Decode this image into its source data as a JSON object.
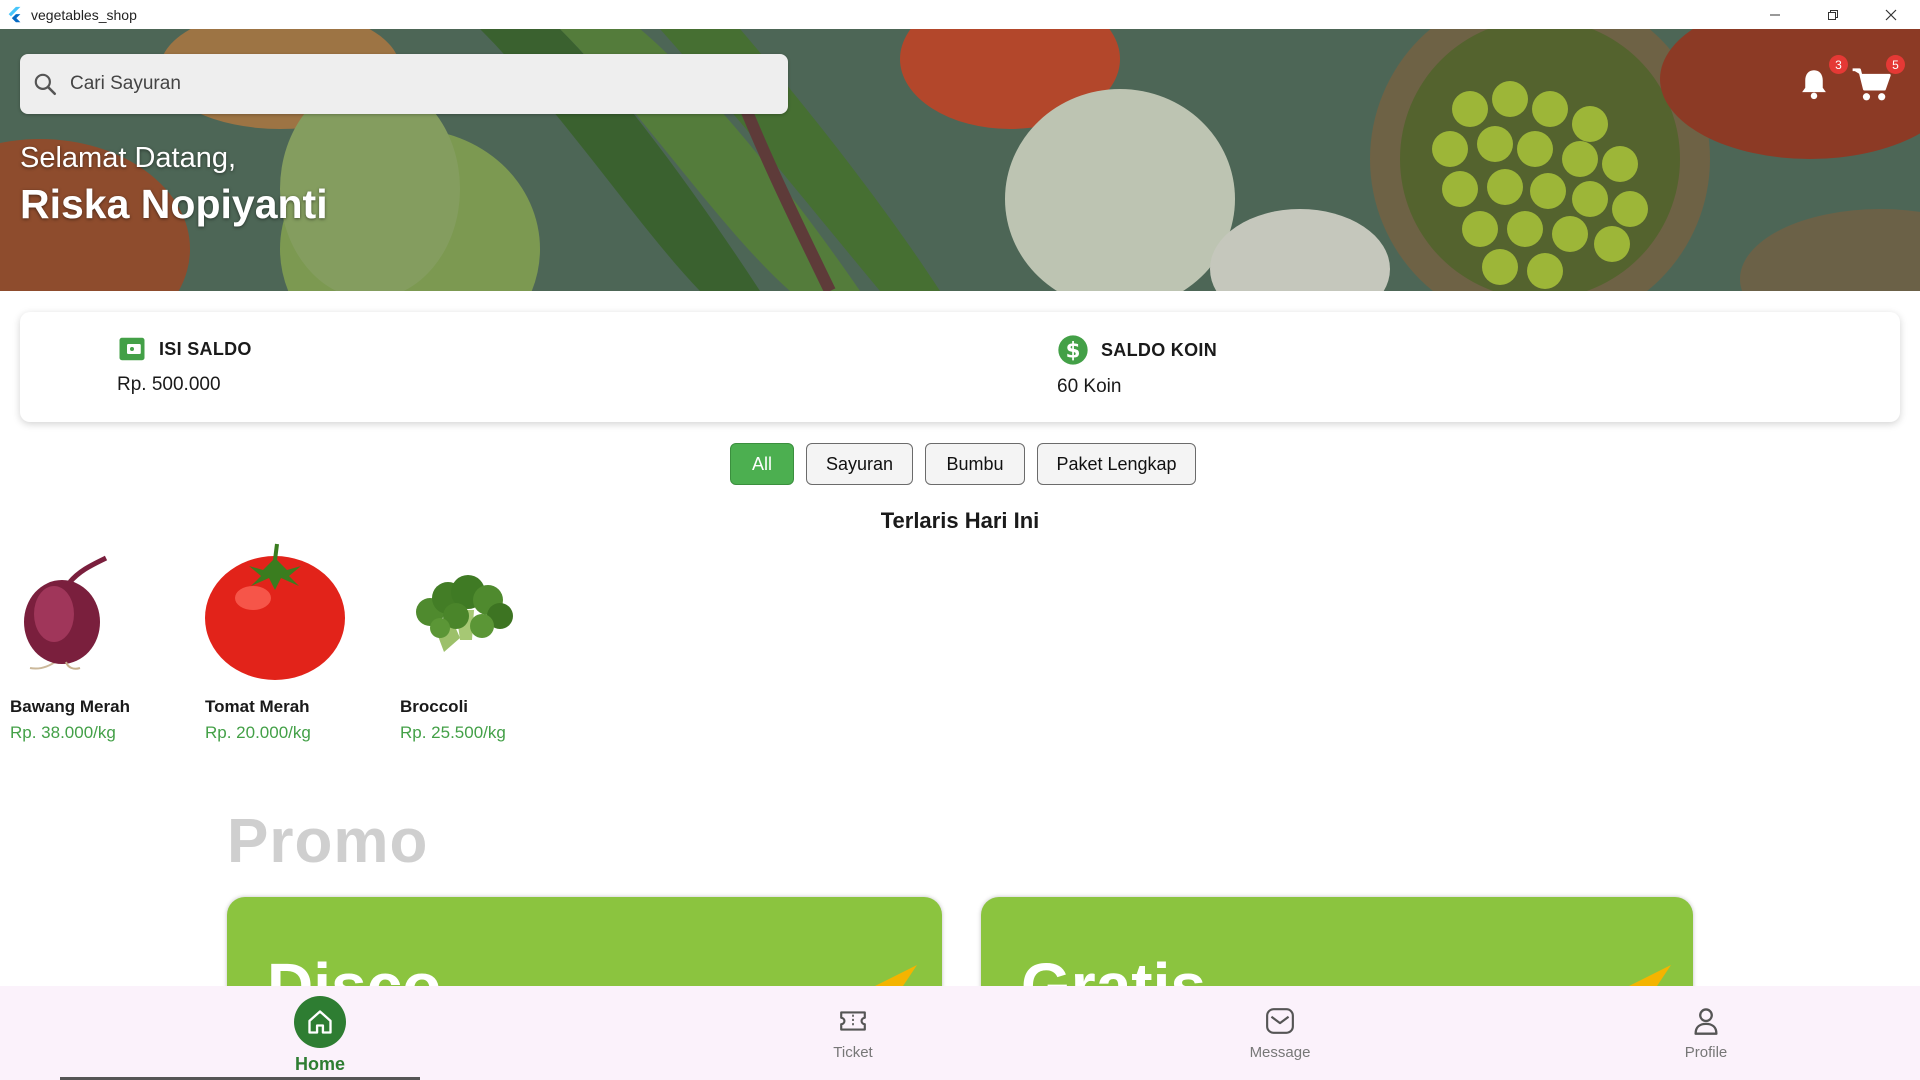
{
  "window": {
    "title": "vegetables_shop"
  },
  "hero": {
    "search_placeholder": "Cari Sayuran",
    "greeting": "Selamat Datang,",
    "user_name": "Riska Nopiyanti",
    "notification_count": "3",
    "cart_count": "5"
  },
  "balance": {
    "topup_label": "ISI SALDO",
    "topup_value": "Rp. 500.000",
    "coin_label": "SALDO KOIN",
    "coin_value": "60 Koin"
  },
  "filters": [
    "All",
    "Sayuran",
    "Bumbu",
    "Paket Lengkap"
  ],
  "active_filter": "All",
  "bestseller_title": "Terlaris Hari Ini",
  "products": [
    {
      "name": "Bawang Merah",
      "price": "Rp. 38.000/kg",
      "icon": "onion"
    },
    {
      "name": "Tomat Merah",
      "price": "Rp. 20.000/kg",
      "icon": "tomato"
    },
    {
      "name": "Broccoli",
      "price": "Rp. 25.500/kg",
      "icon": "broccoli"
    }
  ],
  "promo": {
    "title": "Promo",
    "cards": [
      {
        "text": "Disco"
      },
      {
        "text": "Gratis"
      }
    ]
  },
  "nav": {
    "home": "Home",
    "ticket": "Ticket",
    "message": "Message",
    "profile": "Profile"
  },
  "colors": {
    "accent": "#4caf50",
    "nav_active": "#2e7d32",
    "price": "#43a047",
    "promo": "#8bc43f",
    "badge": "#e53935"
  }
}
